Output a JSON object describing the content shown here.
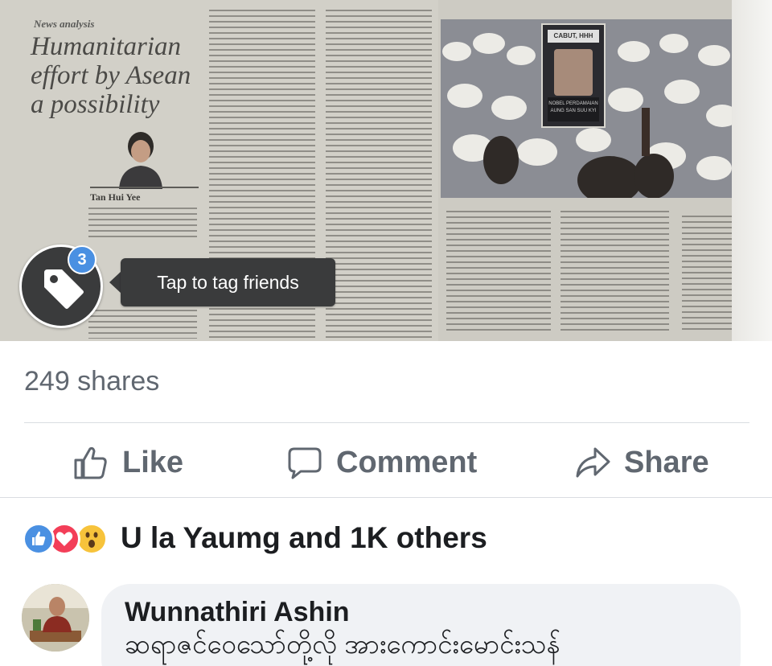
{
  "post_image": {
    "kicker": "News analysis",
    "headline_lines": [
      "Humanitarian",
      "effort by Asean",
      "a possibility"
    ],
    "byline": "Tan Hui Yee",
    "placard_top": "CABUT, HHH",
    "placard_bottom": "NOBEL PERDAMAIAN AUNG SAN SUU KYI"
  },
  "tag_overlay": {
    "badge_count": "3",
    "tooltip": "Tap to tag friends",
    "icon": "tag-icon"
  },
  "stats": {
    "shares": "249 shares"
  },
  "actions": {
    "like_label": "Like",
    "comment_label": "Comment",
    "share_label": "Share"
  },
  "reactions": {
    "icons": [
      "like-reaction-icon",
      "love-reaction-icon",
      "wow-reaction-icon"
    ],
    "summary": "U la Yaumg and 1K others",
    "colors": {
      "like": "#4a90e2",
      "love": "#f33e58",
      "wow": "#f7c33b"
    }
  },
  "comment": {
    "author": "Wunnathiri Ashin",
    "text": "ဆရာဇင်ဝေသော်တို့လို အားကောင်းမောင်းသန်"
  },
  "colors": {
    "tooltip_bg": "#3a3b3c",
    "badge_blue": "#4a90e2",
    "secondary_text": "#606770",
    "comment_bubble": "#f0f2f5"
  }
}
